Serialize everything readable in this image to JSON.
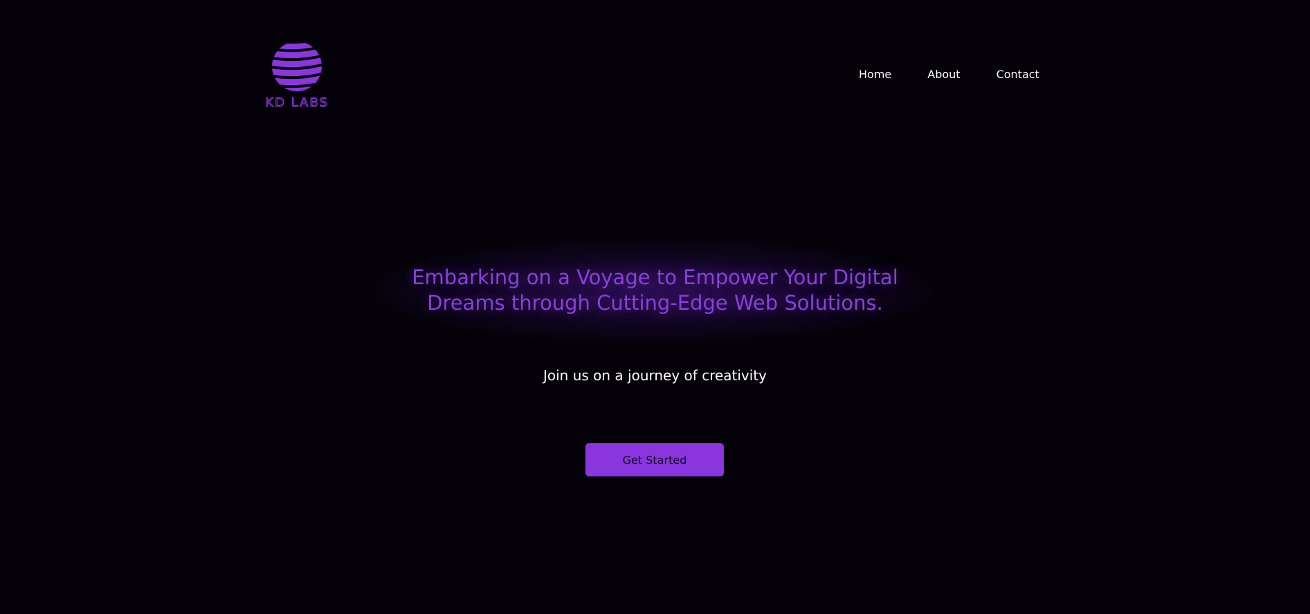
{
  "brand": {
    "name": "KD LABS",
    "logo_icon": "striped-globe-icon",
    "accent_color": "#8a35de"
  },
  "nav": {
    "items": [
      {
        "label": "Home"
      },
      {
        "label": "About"
      },
      {
        "label": "Contact"
      }
    ]
  },
  "hero": {
    "headline_line1": "Embarking on a Voyage to Empower Your Digital",
    "headline_line2": "Dreams through Cutting-Edge Web Solutions.",
    "tagline": "Join us on a journey of creativity",
    "cta_label": "Get Started"
  },
  "colors": {
    "background": "#040208",
    "headline": "#8a3ee0",
    "text": "#ffffff",
    "button": "#8a35de"
  }
}
